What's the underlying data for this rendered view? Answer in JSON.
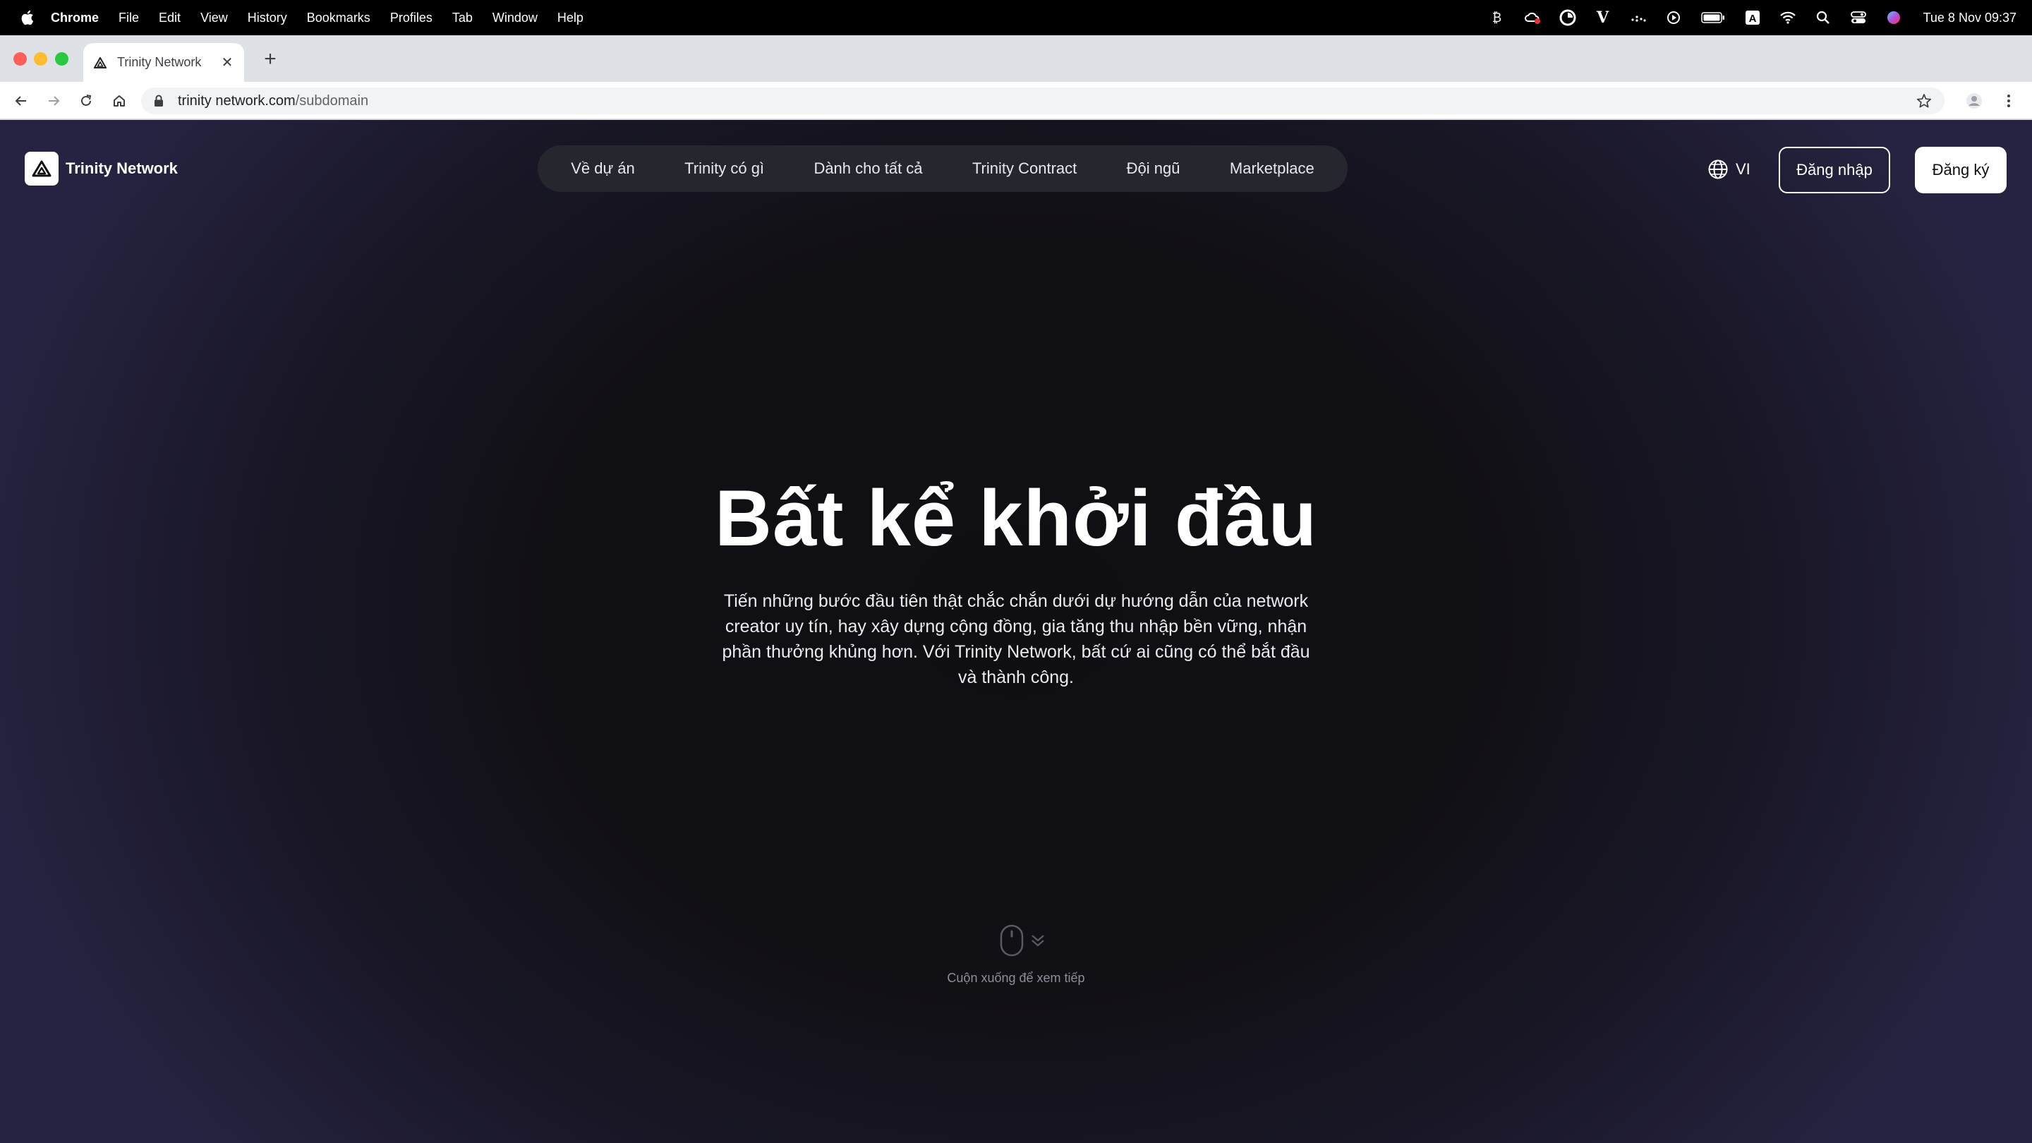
{
  "os_menubar": {
    "app_name": "Chrome",
    "menus": [
      "File",
      "Edit",
      "View",
      "History",
      "Bookmarks",
      "Profiles",
      "Tab",
      "Window",
      "Help"
    ],
    "clock": "Tue 8 Nov  09:37"
  },
  "browser": {
    "tab_title": "Trinity Network",
    "url_host": "trinity network.com",
    "url_path": "/subdomain"
  },
  "site": {
    "logo_text": "Trinity Network",
    "nav": [
      "Về dự án",
      "Trinity có gì",
      "Dành cho tất cả",
      "Trinity Contract",
      "Đội ngũ",
      "Marketplace"
    ],
    "language": "VI",
    "login_label": "Đăng nhập",
    "signup_label": "Đăng ký"
  },
  "hero": {
    "title": "Bất kể khởi đầu",
    "subtitle": "Tiến những bước đầu tiên thật chắc chắn dưới dự hướng dẫn của network creator uy tín, hay xây dựng cộng đồng, gia tăng thu nhập bền vững, nhận phần thưởng khủng hơn. Với Trinity Network, bất cứ ai cũng có thể bắt đầu và thành công.",
    "scroll_hint": "Cuộn xuống để xem tiếp"
  },
  "colors": {
    "page_bg": "#111015",
    "nav_bg": "#25262e",
    "accent_white": "#ffffff"
  }
}
